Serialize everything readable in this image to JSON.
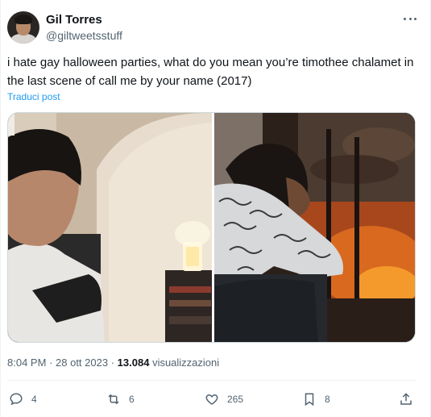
{
  "tweet": {
    "display_name": "Gil Torres",
    "handle": "@giltweetsstuff",
    "text": "i hate gay halloween parties, what do you mean you’re timothee chalamet in the last scene of call me by your name (2017)",
    "translate_label": "Traduci post",
    "time": "8:04 PM",
    "date": "28 ott 2023",
    "views_count": "13.084",
    "views_label": "visualizzazioni",
    "separator": "·"
  },
  "actions": {
    "replies": "4",
    "reposts": "6",
    "likes": "265",
    "bookmarks": "8"
  },
  "icons": [
    "more-icon",
    "reply-icon",
    "repost-icon",
    "like-icon",
    "bookmark-icon",
    "share-icon"
  ],
  "colors": {
    "link": "#1d9bf0",
    "secondary_text": "#536471",
    "primary_text": "#0f1419",
    "divider": "#eff3f4"
  }
}
